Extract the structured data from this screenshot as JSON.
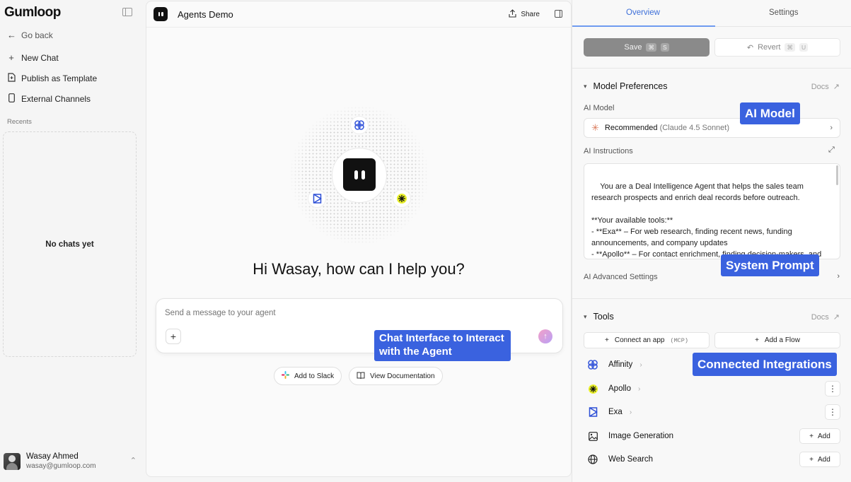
{
  "sidebar": {
    "logo": "Gumloop",
    "go_back": "Go back",
    "items": [
      {
        "label": "New Chat",
        "icon": "plus-icon"
      },
      {
        "label": "Publish as Template",
        "icon": "file-icon"
      },
      {
        "label": "External Channels",
        "icon": "phone-icon"
      }
    ],
    "recents_label": "Recents",
    "empty_state": "No chats yet",
    "user": {
      "name": "Wasay Ahmed",
      "email": "wasay@gumloop.com"
    }
  },
  "center": {
    "title": "Agents Demo",
    "share_label": "Share",
    "greeting": "Hi Wasay, how can I help you?",
    "composer_placeholder": "Send a message to your agent",
    "pills": {
      "slack": "Add to Slack",
      "docs": "View Documentation"
    }
  },
  "right": {
    "tabs": {
      "overview": "Overview",
      "settings": "Settings"
    },
    "save": {
      "label": "Save",
      "keys": [
        "⌘",
        "S"
      ]
    },
    "revert": {
      "label": "Revert",
      "keys": [
        "⌘",
        "U"
      ]
    },
    "model_prefs": {
      "title": "Model Preferences",
      "docs": "Docs",
      "ai_model_label": "AI Model",
      "model_value": "Recommended",
      "model_detail": "(Claude 4.5 Sonnet)",
      "instructions_label": "AI Instructions",
      "instructions_text": "You are a Deal Intelligence Agent that helps the sales team research prospects and enrich deal records before outreach.\n\n**Your available tools:**\n- **Exa** – For web research, finding recent news, funding announcements, and company updates\n- **Apollo** – For contact enrichment, finding decision-makers, and getting verified email addresses\n- **Affinity** – For checking existing",
      "advanced_label": "AI Advanced Settings"
    },
    "tools": {
      "title": "Tools",
      "docs": "Docs",
      "connect_app": "Connect an app",
      "connect_app_tag": "(MCP)",
      "add_flow": "Add a Flow",
      "add_label": "Add",
      "items": [
        {
          "name": "Affinity",
          "icon": "affinity-icon"
        },
        {
          "name": "Apollo",
          "icon": "apollo-icon"
        },
        {
          "name": "Exa",
          "icon": "exa-icon"
        },
        {
          "name": "Image Generation",
          "icon": "image-icon"
        },
        {
          "name": "Web Search",
          "icon": "globe-icon"
        }
      ]
    }
  },
  "annotations": {
    "ai_model": "AI Model",
    "system_prompt": "System Prompt",
    "chat_interface": "Chat Interface to Interact with the Agent",
    "connected_integrations": "Connected Integrations"
  },
  "colors": {
    "accent": "#3d6fd9",
    "callout": "#3a62df",
    "affinity": "#3b5bdb",
    "apollo": "#e8ef2a",
    "claude": "#d97757"
  }
}
